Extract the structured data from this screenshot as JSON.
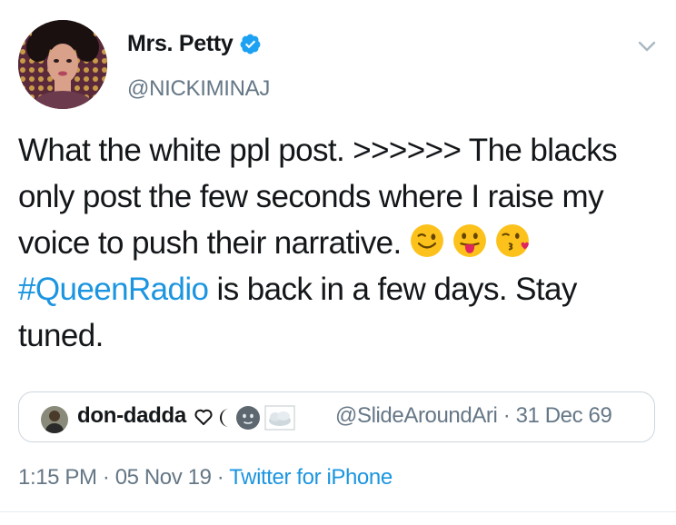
{
  "author": {
    "display_name": "Mrs. Petty",
    "handle": "@NICKIMINAJ",
    "verified": true
  },
  "tweet": {
    "text_1": "What the white ppl post. >>>>>> The blacks only post the few seconds where I raise my voice to push their narrative. ",
    "emoji_1": "winking-face",
    "emoji_2": "face-with-tongue",
    "emoji_3": "face-blowing-kiss",
    "hashtag": "#QueenRadio",
    "text_2": " is back in a few days. Stay tuned."
  },
  "quoted_tweet": {
    "display_name": "don-dadda",
    "name_symbols": [
      "white-heart",
      "crescent-moon",
      "new-moon-face",
      "cloud"
    ],
    "handle_date": "@SlideAroundAri · 31 Dec 69"
  },
  "meta": {
    "time_date": "1:15 PM · 05 Nov 19 · ",
    "source": "Twitter for iPhone"
  },
  "colors": {
    "link": "#1b95e0",
    "secondary_text": "#657786",
    "border": "#ccd6dd"
  }
}
